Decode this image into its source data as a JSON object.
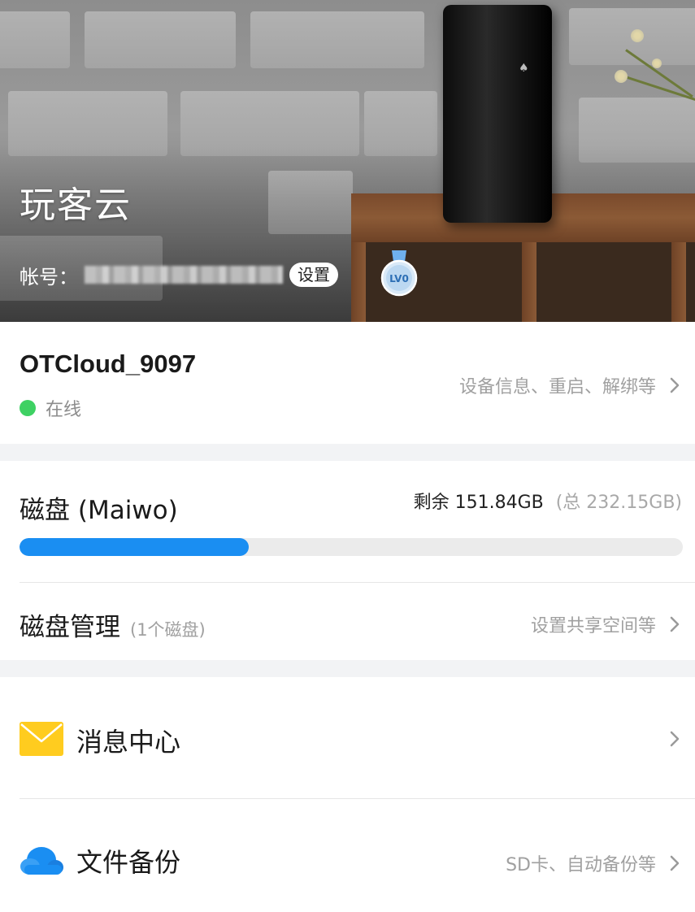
{
  "hero": {
    "app_title": "玩客云",
    "account_label": "帐号：",
    "settings_label": "设置",
    "level_label": "LV0"
  },
  "device": {
    "name": "OTCloud_9097",
    "status": "在线",
    "status_color": "#3ed163",
    "hint": "设备信息、重启、解绑等"
  },
  "disk": {
    "title": "磁盘 (Maiwo)",
    "free_text": "剩余 151.84GB",
    "total_text": "(总 232.15GB)",
    "used_fraction": 0.346,
    "bar_color": "#1a8ef2"
  },
  "disk_management": {
    "title": "磁盘管理",
    "count": "(1个磁盘)",
    "hint": "设置共享空间等"
  },
  "menu": [
    {
      "label": "消息中心",
      "hint": "",
      "icon": "envelope-icon",
      "icon_color": "#ffcc1f"
    },
    {
      "label": "文件备份",
      "hint": "SD卡、自动备份等",
      "icon": "cloud-icon",
      "icon_color": "#1a8ef2"
    }
  ]
}
